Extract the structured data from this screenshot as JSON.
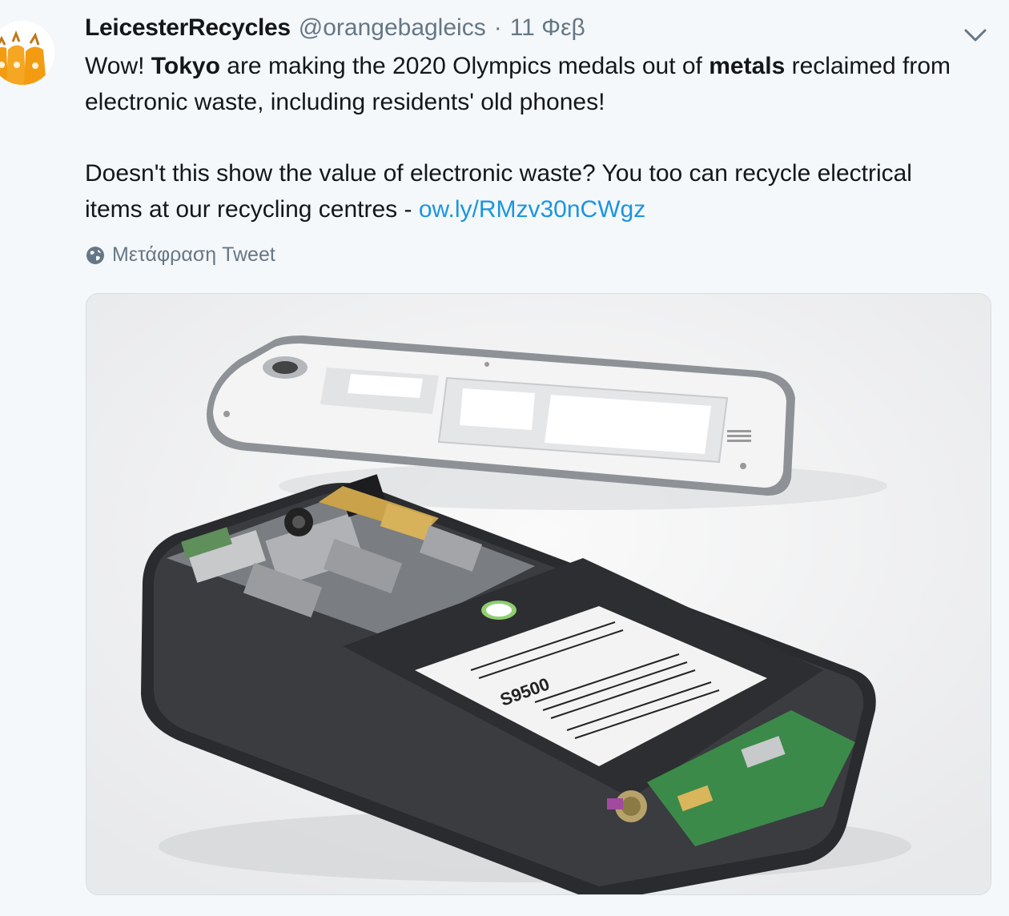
{
  "tweet": {
    "display_name": "LeicesterRecycles",
    "handle": "@orangebagleics",
    "separator": "·",
    "date": "11 Φεβ",
    "paragraph1": {
      "pre": "Wow! ",
      "bold1": "Tokyo",
      "mid": " are making the 2020 Olympics medals out of ",
      "bold2": "metals",
      "post_line1": " reclaimed from",
      "line2": "electronic waste, including residents' old phones!"
    },
    "paragraph2": {
      "line1": "Doesn't this show the value of electronic waste? You too can recycle electrical",
      "line2_pre": "items at our recycling centres - ",
      "link": "ow.ly/RMzv30nCWgz"
    },
    "translate_label": "Μετάφραση Tweet",
    "media": {
      "subject": "disassembled smartphone",
      "battery_text": "S9500"
    }
  },
  "icons": {
    "avatar": "orange-recycling-bags-avatar",
    "menu": "chevron-down-icon",
    "translate": "globe-icon"
  },
  "colors": {
    "link": "#1b95e0",
    "secondary_text": "#657786",
    "background": "#f5f8fa",
    "avatar_orange": "#f39c12"
  }
}
